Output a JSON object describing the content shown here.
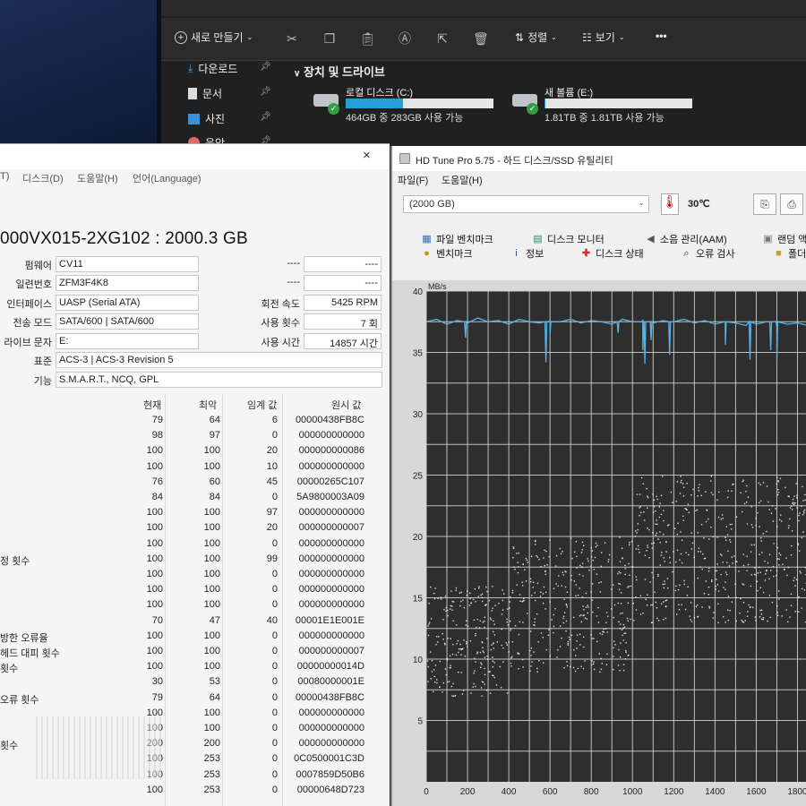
{
  "explorer": {
    "toolbar": {
      "new_label": "새로 만들기",
      "sort_label": "정렬",
      "view_label": "보기",
      "more_label": "•••"
    },
    "nav": [
      {
        "label": "다운로드",
        "icon": "download-icon"
      },
      {
        "label": "문서",
        "icon": "document-icon"
      },
      {
        "label": "사진",
        "icon": "picture-icon"
      },
      {
        "label": "음악",
        "icon": "music-icon"
      }
    ],
    "section_title": "장치 및 드라이브",
    "drives": [
      {
        "name": "로컬 디스크 (C:)",
        "size": "464GB 중 283GB 사용 가능",
        "used_fraction": 0.39
      },
      {
        "name": "새 볼륨 (E:)",
        "size": "1.81TB 중 1.81TB 사용 가능",
        "used_fraction": 0.005
      }
    ]
  },
  "cdi": {
    "menu": [
      "T)",
      "디스크(D)",
      "도움말(H)",
      "언어(Language)"
    ],
    "close": "×",
    "model": "000VX015-2XG102 : 2000.3 GB",
    "fields": {
      "firmware_label": "펌웨어",
      "firmware": "CV11",
      "serial_label": "일련번호",
      "serial": "ZFM3F4K8",
      "interface_label": "인터페이스",
      "interface": "UASP (Serial ATA)",
      "transfer_label": "전송 모드",
      "transfer": "SATA/600 | SATA/600",
      "drive_letter_label": "라이브 문자",
      "drive_letter": "E:",
      "standard_label": "표준",
      "standard": "ACS-3 | ACS-3 Revision 5",
      "features_label": "기능",
      "features": "S.M.A.R.T., NCQ, GPL",
      "blank1": "----",
      "blank2": "----",
      "blank3": "----",
      "blank4": "----",
      "rpm_label": "회전 속도",
      "rpm": "5425 RPM",
      "power_count_label": "사용 횟수",
      "power_count": "7 회",
      "power_hours_label": "사용 시간",
      "power_hours": "14857 시간"
    },
    "table_headers": {
      "current": "현재",
      "worst": "최악",
      "threshold": "임계 값",
      "raw": "원시 값"
    },
    "rows": [
      {
        "name": "",
        "cur": "79",
        "worst": "64",
        "thr": "6",
        "raw": "00000438FB8C"
      },
      {
        "name": "",
        "cur": "98",
        "worst": "97",
        "thr": "0",
        "raw": "000000000000"
      },
      {
        "name": "",
        "cur": "100",
        "worst": "100",
        "thr": "20",
        "raw": "000000000086"
      },
      {
        "name": "",
        "cur": "100",
        "worst": "100",
        "thr": "10",
        "raw": "000000000000"
      },
      {
        "name": "",
        "cur": "76",
        "worst": "60",
        "thr": "45",
        "raw": "00000265C107"
      },
      {
        "name": "",
        "cur": "84",
        "worst": "84",
        "thr": "0",
        "raw": "5A9800003A09"
      },
      {
        "name": "",
        "cur": "100",
        "worst": "100",
        "thr": "97",
        "raw": "000000000000"
      },
      {
        "name": "",
        "cur": "100",
        "worst": "100",
        "thr": "20",
        "raw": "000000000007"
      },
      {
        "name": "",
        "cur": "100",
        "worst": "100",
        "thr": "0",
        "raw": "000000000000"
      },
      {
        "name": "정 횟수",
        "cur": "100",
        "worst": "100",
        "thr": "99",
        "raw": "000000000000"
      },
      {
        "name": "",
        "cur": "100",
        "worst": "100",
        "thr": "0",
        "raw": "000000000000"
      },
      {
        "name": "",
        "cur": "100",
        "worst": "100",
        "thr": "0",
        "raw": "000000000000"
      },
      {
        "name": "",
        "cur": "100",
        "worst": "100",
        "thr": "0",
        "raw": "000000000000"
      },
      {
        "name": "",
        "cur": "70",
        "worst": "47",
        "thr": "40",
        "raw": "00001E1E001E"
      },
      {
        "name": "방한 오류율",
        "cur": "100",
        "worst": "100",
        "thr": "0",
        "raw": "000000000000"
      },
      {
        "name": "헤드 대피 횟수",
        "cur": "100",
        "worst": "100",
        "thr": "0",
        "raw": "000000000007"
      },
      {
        "name": "횟수",
        "cur": "100",
        "worst": "100",
        "thr": "0",
        "raw": "00000000014D"
      },
      {
        "name": "",
        "cur": "30",
        "worst": "53",
        "thr": "0",
        "raw": "00080000001E"
      },
      {
        "name": "오류 횟수",
        "cur": "79",
        "worst": "64",
        "thr": "0",
        "raw": "00000438FB8C"
      },
      {
        "name": "",
        "cur": "100",
        "worst": "100",
        "thr": "0",
        "raw": "000000000000"
      },
      {
        "name": "",
        "cur": "100",
        "worst": "100",
        "thr": "0",
        "raw": "000000000000"
      },
      {
        "name": "횟수",
        "cur": "200",
        "worst": "200",
        "thr": "0",
        "raw": "000000000000"
      },
      {
        "name": "",
        "cur": "100",
        "worst": "253",
        "thr": "0",
        "raw": "0C0500001C3D"
      },
      {
        "name": "",
        "cur": "100",
        "worst": "253",
        "thr": "0",
        "raw": "0007859D50B6"
      },
      {
        "name": "",
        "cur": "100",
        "worst": "253",
        "thr": "0",
        "raw": "00000648D723"
      }
    ]
  },
  "hdtune": {
    "title": "HD Tune Pro 5.75 - 하드 디스크/SSD 유틸리티",
    "menu": [
      "파일(F)",
      "도움말(H)"
    ],
    "drive_select": "(2000 GB)",
    "temperature": "30℃",
    "tabs_row1": [
      {
        "label": "파일 벤치마크",
        "icon": "file-benchmark-icon"
      },
      {
        "label": "디스크 모니터",
        "icon": "disk-monitor-icon"
      },
      {
        "label": "소음 관리(AAM)",
        "icon": "speaker-icon"
      },
      {
        "label": "랜덤 액",
        "icon": "random-access-icon"
      }
    ],
    "tabs_row2": [
      {
        "label": "벤치마크",
        "icon": "benchmark-icon"
      },
      {
        "label": "정보",
        "icon": "info-icon"
      },
      {
        "label": "디스크 상태",
        "icon": "health-icon"
      },
      {
        "label": "오류 검사",
        "icon": "magnifier-icon"
      },
      {
        "label": "폴더",
        "icon": "folder-icon"
      }
    ]
  },
  "chart_data": {
    "type": "line",
    "ylabel": "MB/s",
    "xlim": [
      0,
      1850
    ],
    "ylim": [
      0,
      40
    ],
    "yticks": [
      5,
      10,
      15,
      20,
      25,
      30,
      35,
      40
    ],
    "xticks": [
      0,
      200,
      400,
      600,
      800,
      1000,
      1200,
      1400,
      1600,
      1800
    ],
    "grid": true,
    "colors": {
      "transfer": "#5ab4e8",
      "access": "#ffffff",
      "background": "#2e2e2e"
    },
    "series": [
      {
        "x": [
          0,
          50,
          100,
          150,
          200,
          250,
          300,
          350,
          400,
          450,
          500,
          550,
          600,
          650,
          700,
          750,
          800,
          850,
          900,
          950,
          1000,
          1050,
          1100,
          1150,
          1200,
          1250,
          1300,
          1350,
          1400,
          1450,
          1500,
          1550,
          1600,
          1650,
          1700,
          1750,
          1800,
          1850
        ],
        "values": [
          37.5,
          37.7,
          37.3,
          37.6,
          37.4,
          37.8,
          37.5,
          37.6,
          37.3,
          37.7,
          37.5,
          37.4,
          37.6,
          37.5,
          37.7,
          37.4,
          37.6,
          37.5,
          37.3,
          37.7,
          37.5,
          37.6,
          37.4,
          37.6,
          37.5,
          37.7,
          37.4,
          37.6,
          37.3,
          37.5,
          37.4,
          37.2,
          37.3,
          37.5,
          37.1,
          37.3,
          37.4,
          37.2
        ],
        "dips": [
          [
            190,
            36.2
          ],
          [
            580,
            34.2
          ],
          [
            600,
            36.5
          ],
          [
            930,
            36.6
          ],
          [
            1050,
            35.2
          ],
          [
            1060,
            34.1
          ],
          [
            1090,
            36.0
          ],
          [
            1180,
            34.8
          ],
          [
            1450,
            35.6
          ],
          [
            1570,
            34.4
          ],
          [
            1670,
            35.2
          ],
          [
            1700,
            34.3
          ]
        ]
      }
    ],
    "scatter_bands": [
      {
        "x_range": [
          0,
          400
        ],
        "y_range": [
          7,
          16
        ]
      },
      {
        "x_range": [
          400,
          1000
        ],
        "y_range": [
          9,
          20
        ]
      },
      {
        "x_range": [
          1000,
          1850
        ],
        "y_range": [
          13,
          25
        ]
      }
    ]
  }
}
